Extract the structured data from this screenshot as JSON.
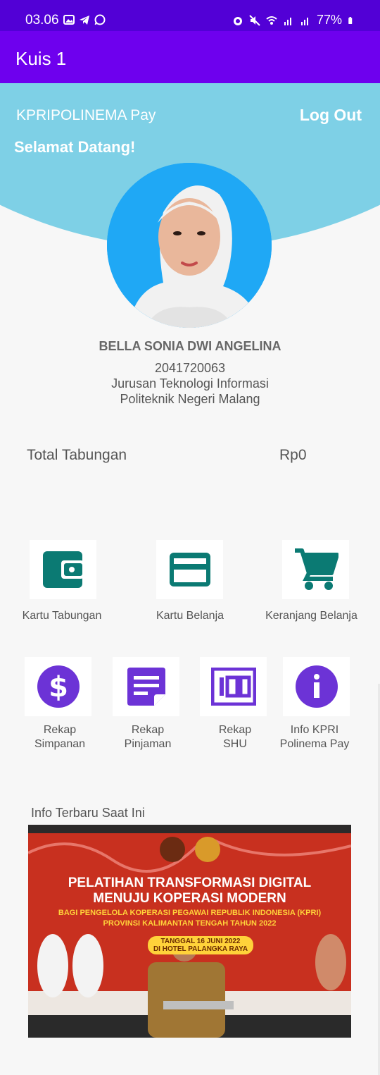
{
  "status_bar": {
    "time": "03.06",
    "battery": "77%"
  },
  "app_bar": {
    "title": "Kuis 1"
  },
  "header": {
    "brand": "KPRIPOLINEMA Pay",
    "logout_label": "Log Out",
    "welcome": "Selamat Datang!"
  },
  "profile": {
    "name": "BELLA SONIA DWI ANGELINA",
    "nim": "2041720063",
    "department": "Jurusan Teknologi Informasi",
    "university": "Politeknik Negeri Malang"
  },
  "savings": {
    "label": "Total Tabungan",
    "value": "Rp0"
  },
  "menu_top": [
    {
      "label": "Kartu Tabungan",
      "icon": "wallet-icon",
      "color": "#0b7a73"
    },
    {
      "label": "Kartu Belanja",
      "icon": "credit-card-icon",
      "color": "#0b7a73"
    },
    {
      "label": "Keranjang Belanja",
      "icon": "shopping-cart-icon",
      "color": "#0b7a73"
    }
  ],
  "menu_bottom": [
    {
      "line1": "Rekap",
      "line2": "Simpanan",
      "icon": "dollar-icon",
      "color": "#6c33d6"
    },
    {
      "line1": "Rekap",
      "line2": "Pinjaman",
      "icon": "note-icon",
      "color": "#6c33d6"
    },
    {
      "line1": "Rekap",
      "line2": "SHU",
      "icon": "hundred-icon",
      "color": "#6c33d6"
    },
    {
      "line1": "Info KPRI",
      "line2": "Polinema Pay",
      "icon": "info-icon",
      "color": "#6c33d6"
    }
  ],
  "info": {
    "title": "Info Terbaru Saat Ini",
    "banner_line1": "PELATIHAN TRANSFORMASI DIGITAL",
    "banner_line2": "MENUJU KOPERASI MODERN",
    "banner_line3": "BAGI PENGELOLA KOPERASI PEGAWAI REPUBLIK INDONESIA (KPRI)",
    "banner_line4": "PROVINSI KALIMANTAN TENGAH TAHUN 2022",
    "banner_date": "TANGGAL 16 JUNI 2022",
    "banner_venue": "DI HOTEL PALANGKA RAYA"
  }
}
